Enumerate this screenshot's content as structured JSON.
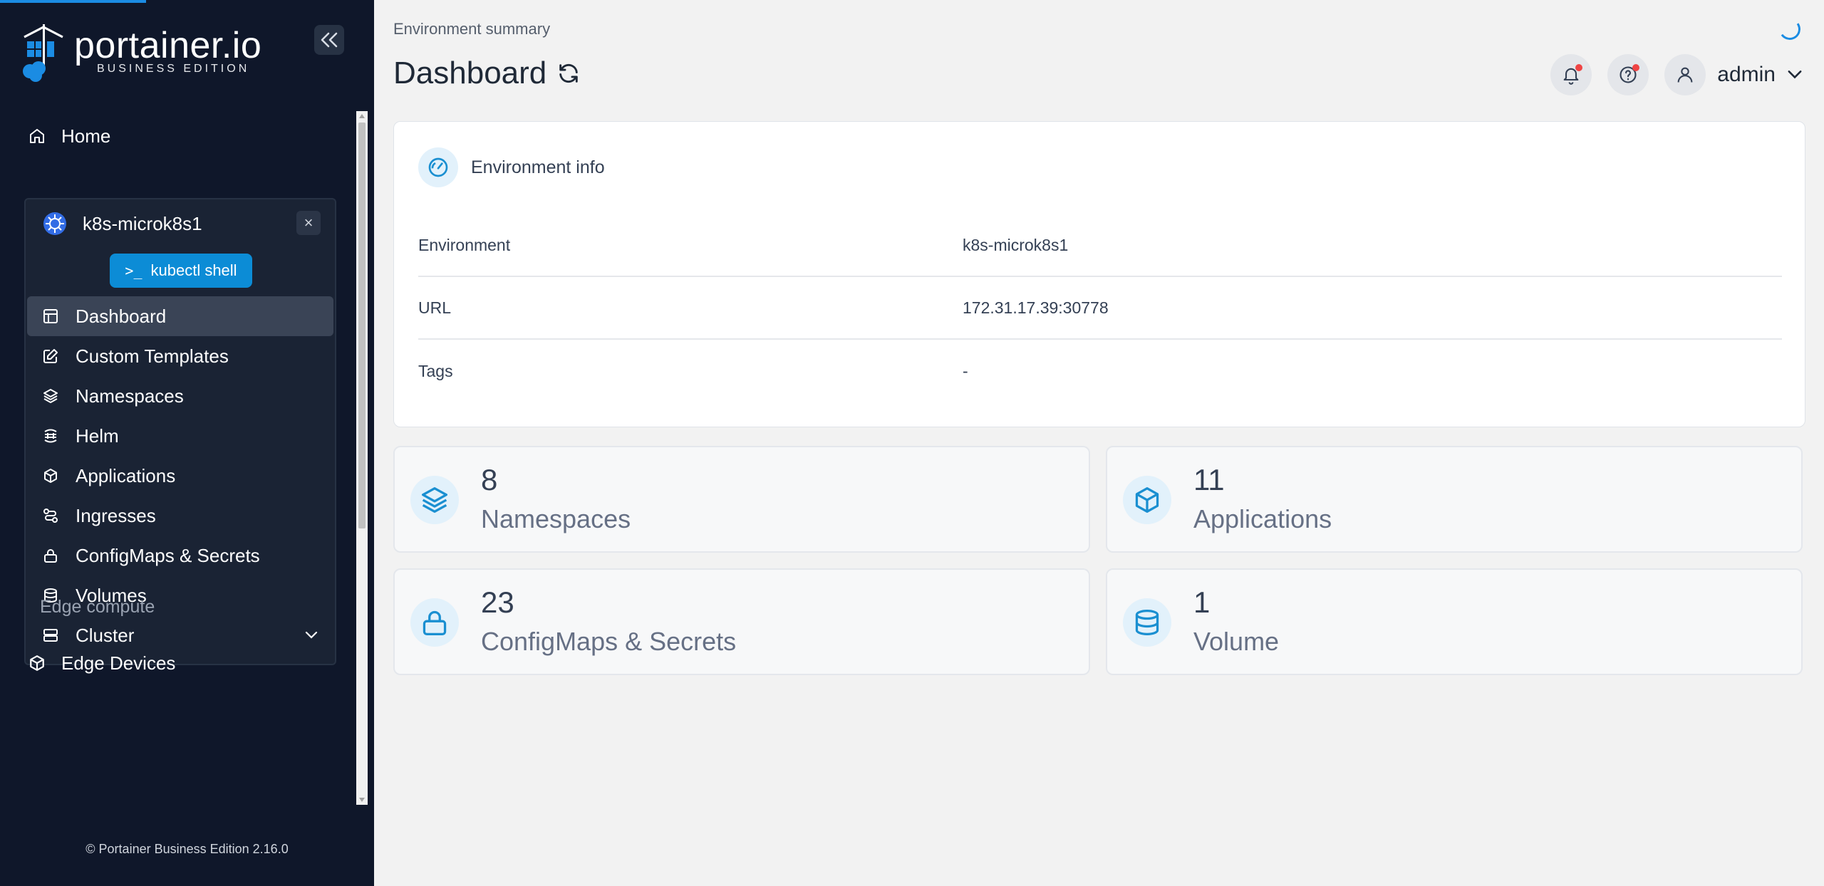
{
  "brand": {
    "name": "portainer.io",
    "edition": "BUSINESS EDITION"
  },
  "sidebar": {
    "home_label": "Home",
    "environment": {
      "name": "k8s-microk8s1",
      "kubectl_label": "kubectl shell"
    },
    "items": [
      {
        "label": "Dashboard",
        "icon": "dashboard-icon",
        "active": true
      },
      {
        "label": "Custom Templates",
        "icon": "edit-icon"
      },
      {
        "label": "Namespaces",
        "icon": "layers-icon"
      },
      {
        "label": "Helm",
        "icon": "helm-icon"
      },
      {
        "label": "Applications",
        "icon": "box-icon"
      },
      {
        "label": "Ingresses",
        "icon": "route-icon"
      },
      {
        "label": "ConfigMaps & Secrets",
        "icon": "lock-icon"
      },
      {
        "label": "Volumes",
        "icon": "database-icon"
      },
      {
        "label": "Cluster",
        "icon": "server-icon"
      }
    ],
    "section_label": "Edge compute",
    "edge_devices_label": "Edge Devices",
    "footer": "© Portainer Business Edition  2.16.0"
  },
  "header": {
    "breadcrumb": "Environment summary",
    "title": "Dashboard",
    "user": "admin"
  },
  "env_info": {
    "title": "Environment info",
    "rows": [
      {
        "key": "Environment",
        "value": "k8s-microk8s1"
      },
      {
        "key": "URL",
        "value": "172.31.17.39:30778"
      },
      {
        "key": "Tags",
        "value": "-"
      }
    ]
  },
  "stats": [
    {
      "count": "8",
      "label": "Namespaces",
      "icon": "layers-icon"
    },
    {
      "count": "11",
      "label": "Applications",
      "icon": "box-icon"
    },
    {
      "count": "23",
      "label": "ConfigMaps & Secrets",
      "icon": "lock-icon"
    },
    {
      "count": "1",
      "label": "Volume",
      "icon": "database-icon"
    }
  ],
  "colors": {
    "sidebar_bg": "#0f172a",
    "accent": "#0c8cd6",
    "icon_blue": "#1a8fd1"
  }
}
